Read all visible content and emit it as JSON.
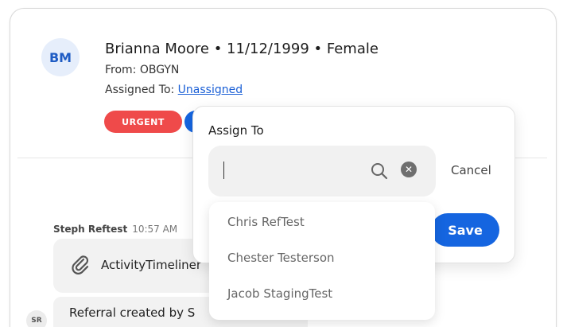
{
  "patient": {
    "initials": "BM",
    "name_line": "Brianna Moore • 11/12/1999 • Female",
    "from_line": "From: OBGYN",
    "assigned_label": "Assigned To: ",
    "assigned_value": "Unassigned"
  },
  "badges": {
    "urgent_label": "URGENT",
    "urgent_color": "#ef4a4a",
    "blue_color": "#1565e0"
  },
  "activity": {
    "author": "Steph Reftest",
    "time": "10:57 AM",
    "attachment_name": "ActivityTimeliner",
    "referral_avatar": "SR",
    "referral_text": "Referral created by  S"
  },
  "assign_popup": {
    "title": "Assign To",
    "search_value": "",
    "cancel_label": "Cancel",
    "save_label": "Save",
    "options": [
      "Chris RefTest",
      "Chester Testerson",
      "Jacob StagingTest"
    ]
  },
  "icons": {
    "search": "search-icon",
    "clear": "clear-icon",
    "paperclip": "paperclip-icon"
  }
}
